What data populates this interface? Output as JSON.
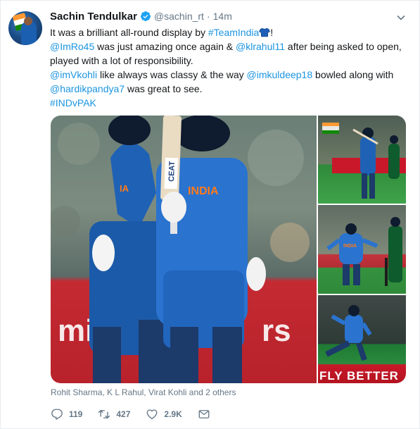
{
  "tweet": {
    "author_name": "Sachin Tendulkar",
    "handle": "@sachin_rt",
    "separator": "·",
    "time": "14m",
    "lines": [
      [
        {
          "t": "It was a brilliant all-round display by ",
          "link": false
        },
        {
          "t": "#TeamIndia",
          "link": true
        },
        {
          "t": "👕",
          "emoji": true
        },
        {
          "t": "!",
          "link": false
        }
      ],
      [
        {
          "t": "@ImRo45",
          "link": true
        },
        {
          "t": " was just amazing once again & ",
          "link": false
        },
        {
          "t": "@klrahul11",
          "link": true
        },
        {
          "t": " after being asked to open, played with a lot of responsibility.",
          "link": false
        }
      ],
      [
        {
          "t": "@imVkohli",
          "link": true
        },
        {
          "t": " like always was classy & the way ",
          "link": false
        },
        {
          "t": "@imkuldeep18",
          "link": true
        },
        {
          "t": " bowled along with ",
          "link": false
        },
        {
          "t": "@hardikpandya7",
          "link": true
        },
        {
          "t": " was great to see.",
          "link": false
        }
      ],
      [
        {
          "t": "#INDvPAK",
          "link": true
        }
      ]
    ],
    "media": {
      "main_jersey_text": "INDIA",
      "main_bat_text": "CEAT",
      "side3_ad_text": "FLY BETTER",
      "side2_jersey_text": "INDIA"
    },
    "tagged": "Rohit Sharma, K L Rahul, Virat Kohli and 2 others",
    "actions": {
      "reply_count": "119",
      "retweet_count": "427",
      "like_count": "2.9K"
    },
    "colors": {
      "link": "#1b95e0",
      "secondary": "#657786",
      "verified": "#1da1f2"
    }
  }
}
